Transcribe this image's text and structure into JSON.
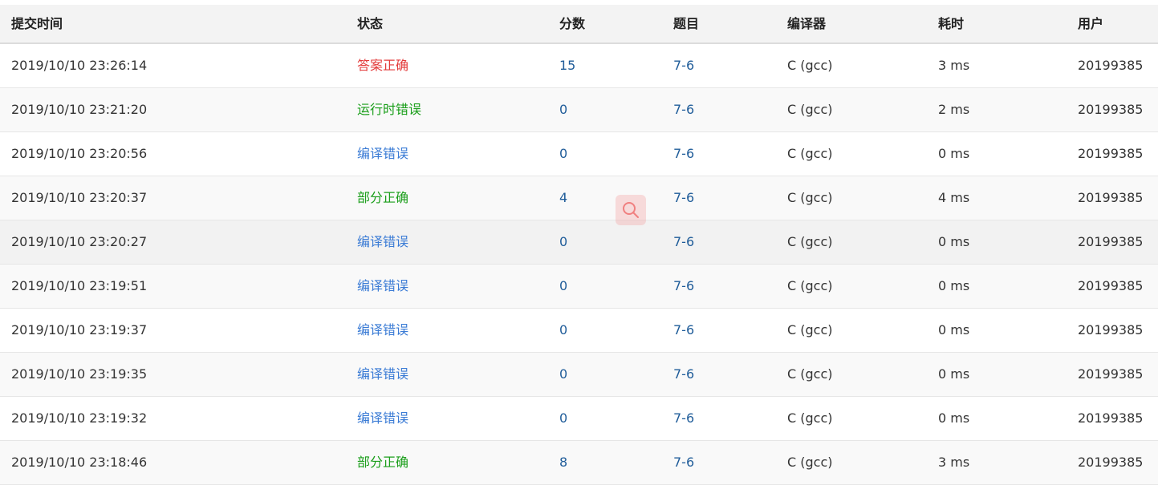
{
  "headers": [
    "提交时间",
    "状态",
    "分数",
    "题目",
    "编译器",
    "耗时",
    "用户"
  ],
  "colors": {
    "accepted": "#e33b3b",
    "runtime_error": "#1a9e1a",
    "partially_accepted": "#1a9e1a",
    "compile_error": "#3a7bd5",
    "link": "#1f5c99",
    "zoom_icon": "#f08080"
  },
  "rows": [
    {
      "time": "2019/10/10 23:26:14",
      "status": "答案正确",
      "status_color": "#e33b3b",
      "score": "15",
      "problem": "7-6",
      "compiler": "C (gcc)",
      "elapsed": "3 ms",
      "user": "20199385"
    },
    {
      "time": "2019/10/10 23:21:20",
      "status": "运行时错误",
      "status_color": "#1a9e1a",
      "score": "0",
      "problem": "7-6",
      "compiler": "C (gcc)",
      "elapsed": "2 ms",
      "user": "20199385"
    },
    {
      "time": "2019/10/10 23:20:56",
      "status": "编译错误",
      "status_color": "#3a7bd5",
      "score": "0",
      "problem": "7-6",
      "compiler": "C (gcc)",
      "elapsed": "0 ms",
      "user": "20199385"
    },
    {
      "time": "2019/10/10 23:20:37",
      "status": "部分正确",
      "status_color": "#1a9e1a",
      "score": "4",
      "problem": "7-6",
      "compiler": "C (gcc)",
      "elapsed": "4 ms",
      "user": "20199385"
    },
    {
      "time": "2019/10/10 23:20:27",
      "status": "编译错误",
      "status_color": "#3a7bd5",
      "score": "0",
      "problem": "7-6",
      "compiler": "C (gcc)",
      "elapsed": "0 ms",
      "user": "20199385"
    },
    {
      "time": "2019/10/10 23:19:51",
      "status": "编译错误",
      "status_color": "#3a7bd5",
      "score": "0",
      "problem": "7-6",
      "compiler": "C (gcc)",
      "elapsed": "0 ms",
      "user": "20199385"
    },
    {
      "time": "2019/10/10 23:19:37",
      "status": "编译错误",
      "status_color": "#3a7bd5",
      "score": "0",
      "problem": "7-6",
      "compiler": "C (gcc)",
      "elapsed": "0 ms",
      "user": "20199385"
    },
    {
      "time": "2019/10/10 23:19:35",
      "status": "编译错误",
      "status_color": "#3a7bd5",
      "score": "0",
      "problem": "7-6",
      "compiler": "C (gcc)",
      "elapsed": "0 ms",
      "user": "20199385"
    },
    {
      "time": "2019/10/10 23:19:32",
      "status": "编译错误",
      "status_color": "#3a7bd5",
      "score": "0",
      "problem": "7-6",
      "compiler": "C (gcc)",
      "elapsed": "0 ms",
      "user": "20199385"
    },
    {
      "time": "2019/10/10 23:18:46",
      "status": "部分正确",
      "status_color": "#1a9e1a",
      "score": "8",
      "problem": "7-6",
      "compiler": "C (gcc)",
      "elapsed": "3 ms",
      "user": "20199385"
    }
  ],
  "hovered_row": 4,
  "zoom_icon": "search-icon"
}
